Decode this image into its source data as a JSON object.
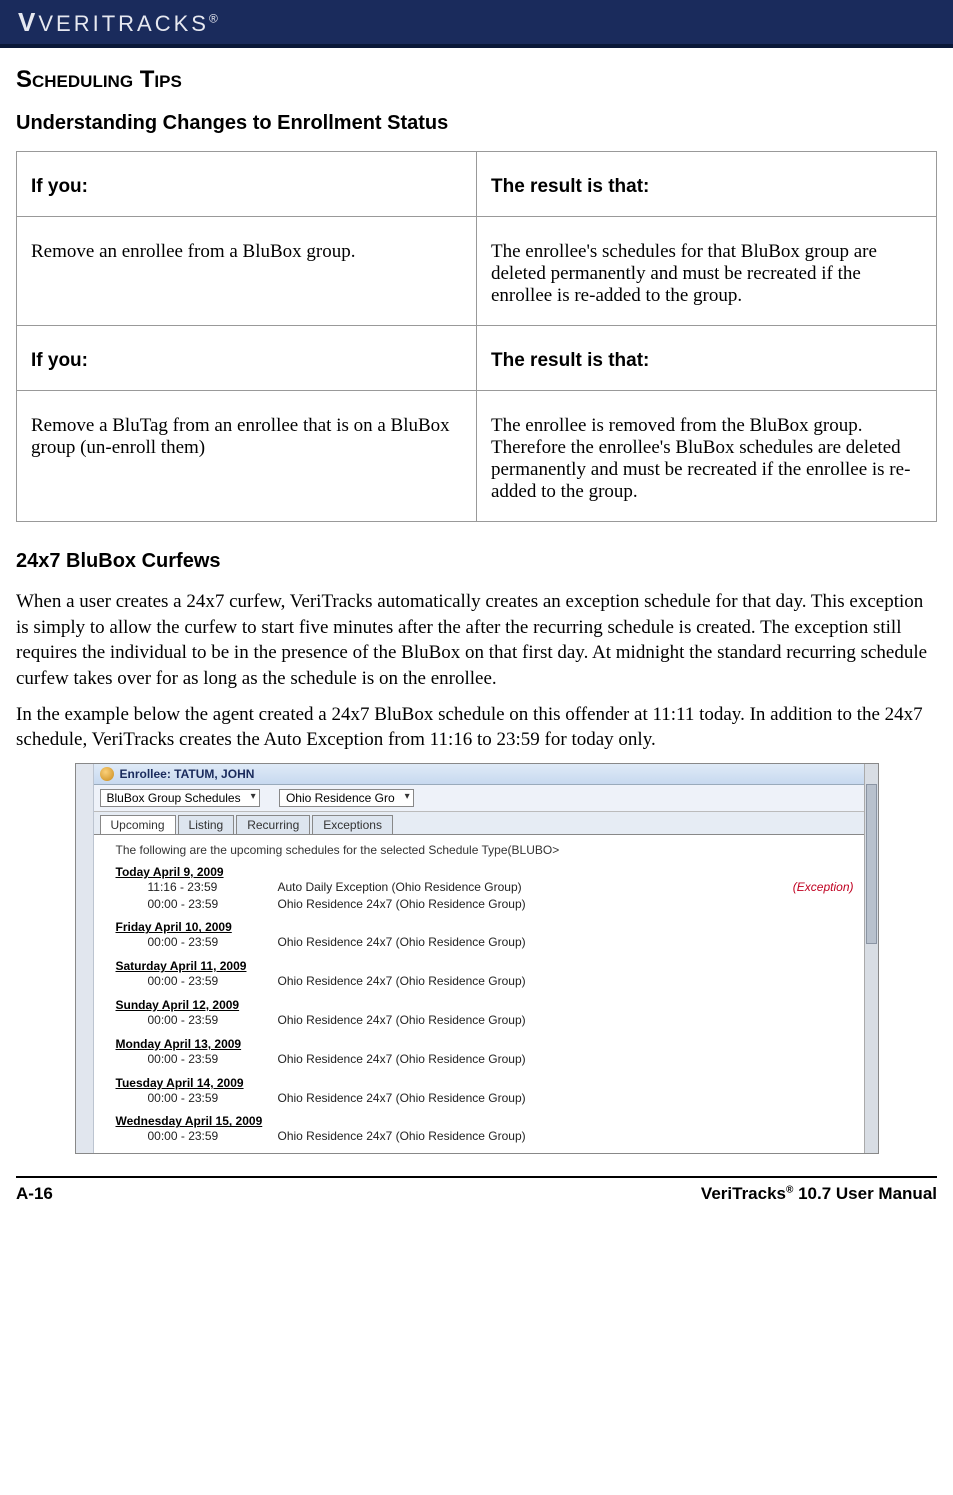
{
  "brand": "VERITRACKS",
  "brand_mark": "®",
  "h1": "Scheduling Tips",
  "h2a": "Understanding Changes to Enrollment Status",
  "table": {
    "hd1a": "If you:",
    "hd1b": "The result is that:",
    "r1a": "Remove an enrollee from a BluBox group.",
    "r1b": "The enrollee's schedules for that BluBox group are deleted permanently and must be recreated if the enrollee is re-added to the group.",
    "hd2a": "If you:",
    "hd2b": "The result is that:",
    "r2a": "Remove a BluTag from an enrollee that is on a BluBox group (un-enroll them)",
    "r2b": "The enrollee is removed from the BluBox group.  Therefore the enrollee's BluBox schedules are deleted permanently and must be recreated if the enrollee is re-added to the group."
  },
  "h2b": "24x7 BluBox Curfews",
  "p1": "When a user creates a 24x7 curfew, VeriTracks automatically creates an exception schedule for that day.  This exception is simply to allow the curfew to start five minutes after the after the recurring schedule is created.  The exception still requires the individual to be in the presence of the BluBox on that first day.  At midnight the standard recurring schedule curfew takes over for as long as the schedule is on the enrollee.",
  "p2": "In the example below the agent created a 24x7 BluBox schedule on this offender at 11:11 today.  In addition to the 24x7 schedule, VeriTracks creates the Auto Exception from 11:16 to 23:59 for today only.",
  "ss": {
    "title": "Enrollee: TATUM, JOHN",
    "select1": "BluBox Group Schedules",
    "select2": "Ohio Residence Gro",
    "tabs": [
      "Upcoming",
      "Listing",
      "Recurring",
      "Exceptions"
    ],
    "active_tab": 0,
    "note": "The following are the upcoming schedules for the selected Schedule Type(BLUBO>",
    "days": [
      {
        "label": "Today April 9, 2009",
        "rows": [
          {
            "time": "11:16 - 23:59",
            "desc": "Auto Daily Exception (Ohio Residence Group)",
            "ex": "(Exception)"
          },
          {
            "time": "00:00 - 23:59",
            "desc": "Ohio Residence 24x7 (Ohio Residence Group)"
          }
        ]
      },
      {
        "label": "Friday April 10, 2009",
        "rows": [
          {
            "time": "00:00 - 23:59",
            "desc": "Ohio Residence 24x7 (Ohio Residence Group)"
          }
        ]
      },
      {
        "label": "Saturday April 11, 2009",
        "rows": [
          {
            "time": "00:00 - 23:59",
            "desc": "Ohio Residence 24x7 (Ohio Residence Group)"
          }
        ]
      },
      {
        "label": "Sunday April 12, 2009",
        "rows": [
          {
            "time": "00:00 - 23:59",
            "desc": "Ohio Residence 24x7 (Ohio Residence Group)"
          }
        ]
      },
      {
        "label": "Monday April 13, 2009",
        "rows": [
          {
            "time": "00:00 - 23:59",
            "desc": "Ohio Residence 24x7 (Ohio Residence Group)"
          }
        ]
      },
      {
        "label": "Tuesday April 14, 2009",
        "rows": [
          {
            "time": "00:00 - 23:59",
            "desc": "Ohio Residence 24x7 (Ohio Residence Group)"
          }
        ]
      },
      {
        "label": "Wednesday April 15, 2009",
        "rows": [
          {
            "time": "00:00 - 23:59",
            "desc": "Ohio Residence 24x7 (Ohio Residence Group)"
          }
        ]
      }
    ]
  },
  "footer": {
    "left": "A-16",
    "right_a": "VeriTracks",
    "right_sup": "®",
    "right_b": " 10.7 User Manual"
  }
}
